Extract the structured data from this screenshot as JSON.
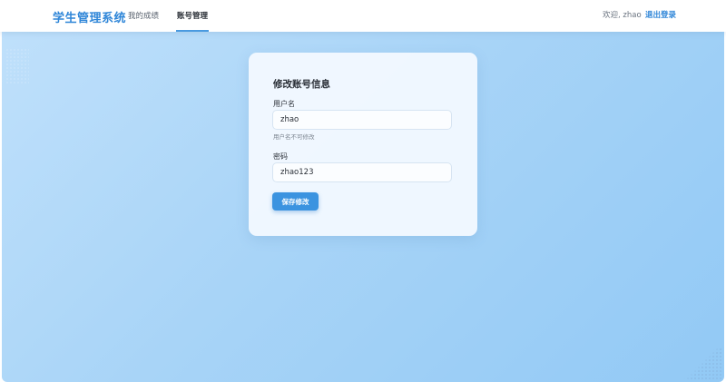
{
  "header": {
    "brand": "学生管理系统",
    "tabs": [
      {
        "label": "我的成绩",
        "active": false
      },
      {
        "label": "账号管理",
        "active": true
      }
    ],
    "welcome": "欢迎, zhao",
    "logout_label": "退出登录"
  },
  "account_form": {
    "title": "修改账号信息",
    "username": {
      "label": "用户名",
      "value": "zhao",
      "hint": "用户名不可修改"
    },
    "password": {
      "label": "密码",
      "value": "zhao123"
    },
    "save_label": "保存修改"
  },
  "colors": {
    "brand": "#2f86d8",
    "primary_button": "#3b93e0",
    "background_start": "#bfe0fb",
    "background_end": "#92c9f5"
  }
}
